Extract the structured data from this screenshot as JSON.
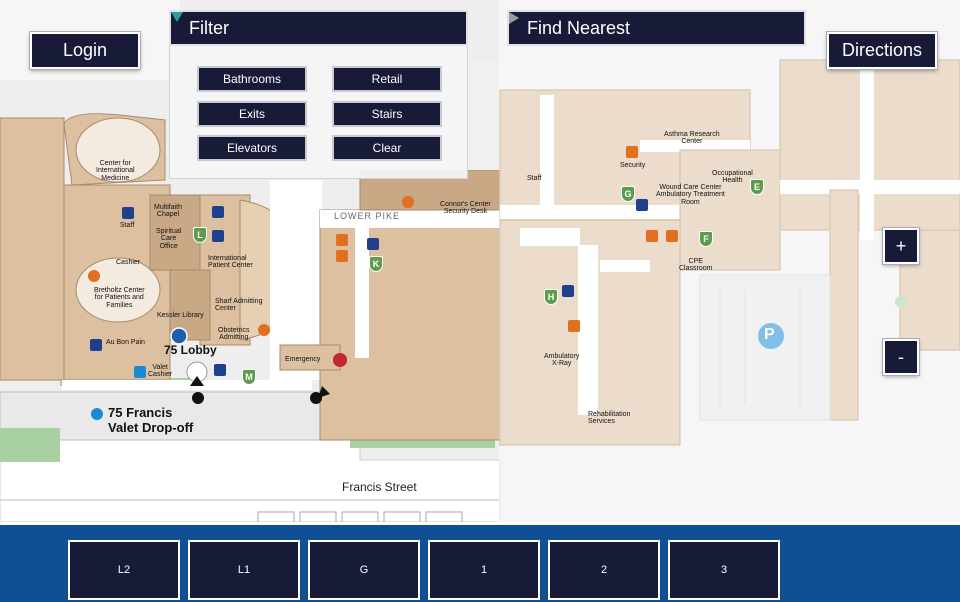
{
  "toolbar": {
    "login_label": "Login",
    "directions_label": "Directions",
    "filter_label": "Filter",
    "find_nearest_label": "Find Nearest",
    "zoom_in_label": "+",
    "zoom_out_label": "-"
  },
  "filter": {
    "buttons": [
      "Bathrooms",
      "Retail",
      "Exits",
      "Stairs",
      "Elevators",
      "Clear"
    ]
  },
  "floors": [
    "L2",
    "L1",
    "G",
    "1",
    "2",
    "3"
  ],
  "map": {
    "street": "Francis Street",
    "corridor": "LOWER PIKE",
    "lobby": "75 Lobby",
    "valet_dropoff_line1": "75 Francis",
    "valet_dropoff_line2": "Valet Drop-off",
    "parking_symbol": "P",
    "labels": {
      "center_intl_medicine": "Center for\nInternational\nMedicine",
      "staff_left": "Staff",
      "cashier": "Cashier",
      "multifaith_chapel": "Multifaith\nChapel",
      "spiritual_care": "Spiritual\nCare\nOffice",
      "international_patient": "International\nPatient Center",
      "bretholtz": "Bretholtz Center\nfor Patients and\nFamilies",
      "kessler": "Kessler Library",
      "sharf": "Sharf Admitting\nCenter",
      "obstetrics": "Obstetrics\nAdmitting",
      "au_bon_pain": "Au Bon Pain",
      "valet_cashier": "Valet\nCashier",
      "emergency": "Emergency",
      "connors_center": "Connor's Center\nSecurity Desk",
      "staff_mid": "Staff",
      "asthma": "Asthma Research\nCenter",
      "security": "Security",
      "occupational": "Occupational\nHealth",
      "wound_care": "Wound Care Center\nAmbulatory Treatment\nRoom",
      "cpe": "CPE\nClassroom",
      "ambulatory_xray": "Ambulatory\nX-Ray",
      "rehab": "Rehabilitation\nServices"
    },
    "elevator_letters": [
      "L",
      "K",
      "M",
      "G",
      "E",
      "F",
      "H"
    ]
  },
  "colors": {
    "building": "#dcc0a0",
    "building_dark": "#c9a885",
    "corridor": "#ffffff",
    "ground": "#eeeeee",
    "green": "#a8d0a0",
    "button_bg": "#171b38",
    "floorbar": "#0f4f93"
  }
}
